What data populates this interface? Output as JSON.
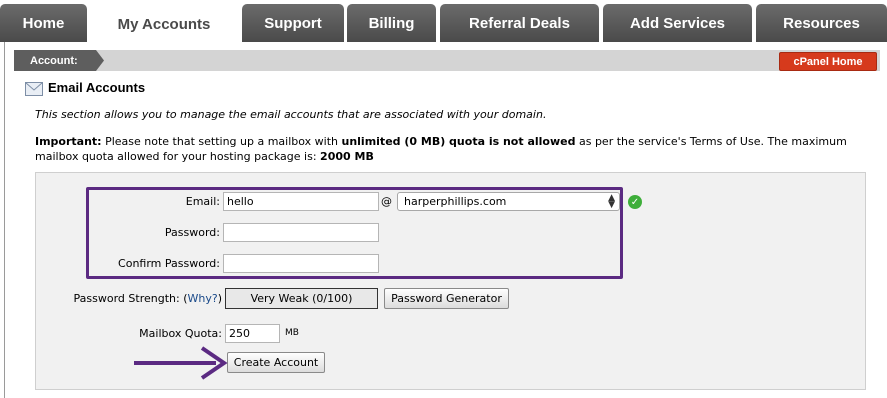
{
  "nav": {
    "tabs": [
      {
        "label": "Home"
      },
      {
        "label": "My Accounts"
      },
      {
        "label": "Support"
      },
      {
        "label": "Billing"
      },
      {
        "label": "Referral Deals"
      },
      {
        "label": "Add Services"
      },
      {
        "label": "Resources"
      }
    ],
    "active_tab": "My Accounts"
  },
  "account_bar": {
    "label": "Account:",
    "cpanel_home": "cPanel Home"
  },
  "section": {
    "title": "Email Accounts",
    "icon": "envelope-icon",
    "intro": "This section allows you to manage the email accounts that are associated with your domain.",
    "important_label": "Important:",
    "important_text_1": " Please note that setting up a mailbox with ",
    "important_bold_1": "unlimited (0 MB) quota is not allowed",
    "important_text_2": " as per the service's Terms of Use. The maximum mailbox quota allowed for your hosting package is: ",
    "important_bold_2": "2000 MB"
  },
  "form": {
    "email_label": "Email:",
    "email_value": "hello",
    "at_sign": "@",
    "domain_selected": "harperphillips.com",
    "password_label": "Password:",
    "password_value": "",
    "confirm_label": "Confirm Password:",
    "confirm_value": "",
    "strength_label": "Password Strength:",
    "why_open": "(",
    "why_link": "Why?",
    "why_close": ")",
    "strength_value": "Very Weak (0/100)",
    "generator_button": "Password Generator",
    "quota_label": "Mailbox Quota:",
    "quota_value": "250",
    "quota_unit": "MB",
    "create_button": "Create Account"
  },
  "colors": {
    "highlight": "#5b2a82",
    "cpanel_button": "#d63a1c",
    "check": "#3eae3a"
  }
}
